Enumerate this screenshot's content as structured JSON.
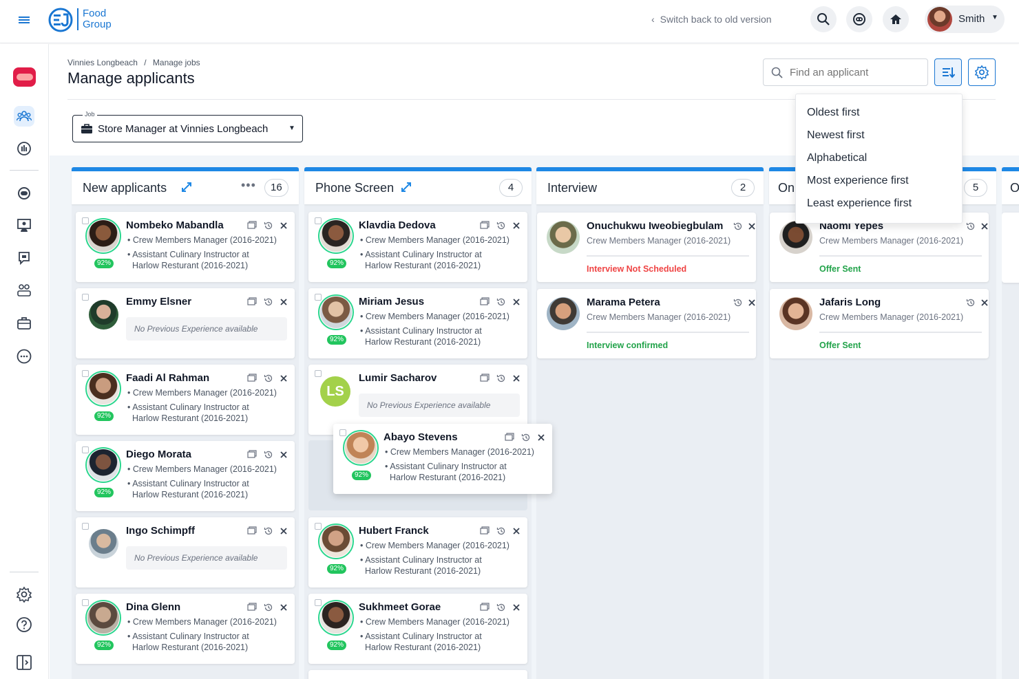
{
  "topbar": {
    "logo_top": "Food",
    "logo_bottom": "Group",
    "switch_back": "Switch back to old version",
    "user_name": "Smith"
  },
  "breadcrumb": {
    "item1": "Vinnies Longbeach",
    "sep": "/",
    "item2": "Manage jobs"
  },
  "page_title": "Manage applicants",
  "search": {
    "placeholder": "Find an applicant"
  },
  "job_select": {
    "label": "Job",
    "value": "Store Manager at Vinnies Longbeach"
  },
  "sort_menu": {
    "items": [
      "Oldest first",
      "Newest first",
      "Alphabetical",
      "Most experience first",
      "Least experience first"
    ]
  },
  "columns": [
    {
      "title": "New applicants",
      "count": "16"
    },
    {
      "title": "Phone Screen",
      "count": "4"
    },
    {
      "title": "Interview",
      "count": "2"
    },
    {
      "title": "On",
      "count": "5"
    },
    {
      "title": "O",
      "count": ""
    }
  ],
  "common": {
    "exp1": "• Crew Members Manager (2016-2021)",
    "exp2a": "Assistant Culinary Instructor at",
    "exp2b": "Harlow Resturant (2016-2021)",
    "bullet": "•",
    "no_exp": "No Previous Experience available",
    "match": "92%",
    "sub": "Crew Members Manager (2016-2021)"
  },
  "new_applicants": [
    "Nombeko Mabandla",
    "Emmy Elsner",
    "Faadi Al Rahman",
    "Diego Morata",
    "Ingo Schimpff",
    "Dina Glenn"
  ],
  "phone_screen": [
    "Klavdia Dedova",
    "Miriam Jesus",
    "Lumir Sacharov",
    "Hubert Franck",
    "Sukhmeet Gorae"
  ],
  "dragging": {
    "name": "Abayo Stevens"
  },
  "lumir_initials": "LS",
  "interview": [
    {
      "name": "Onuchukwu Iweobiegbulam",
      "status": "Interview Not Scheduled",
      "color": "#ef4444"
    },
    {
      "name": "Marama Petera",
      "status": "Interview confirmed",
      "color": "#22a34a"
    }
  ],
  "offer": [
    {
      "name": "Naomi Yepes",
      "status": "Offer Sent",
      "color": "#22a34a"
    },
    {
      "name": "Jafaris Long",
      "status": "Offer Sent",
      "color": "#22a34a"
    }
  ],
  "colors": {
    "accent": "#1e88e5",
    "brand": "#1976d2",
    "match": "#22c55e"
  }
}
